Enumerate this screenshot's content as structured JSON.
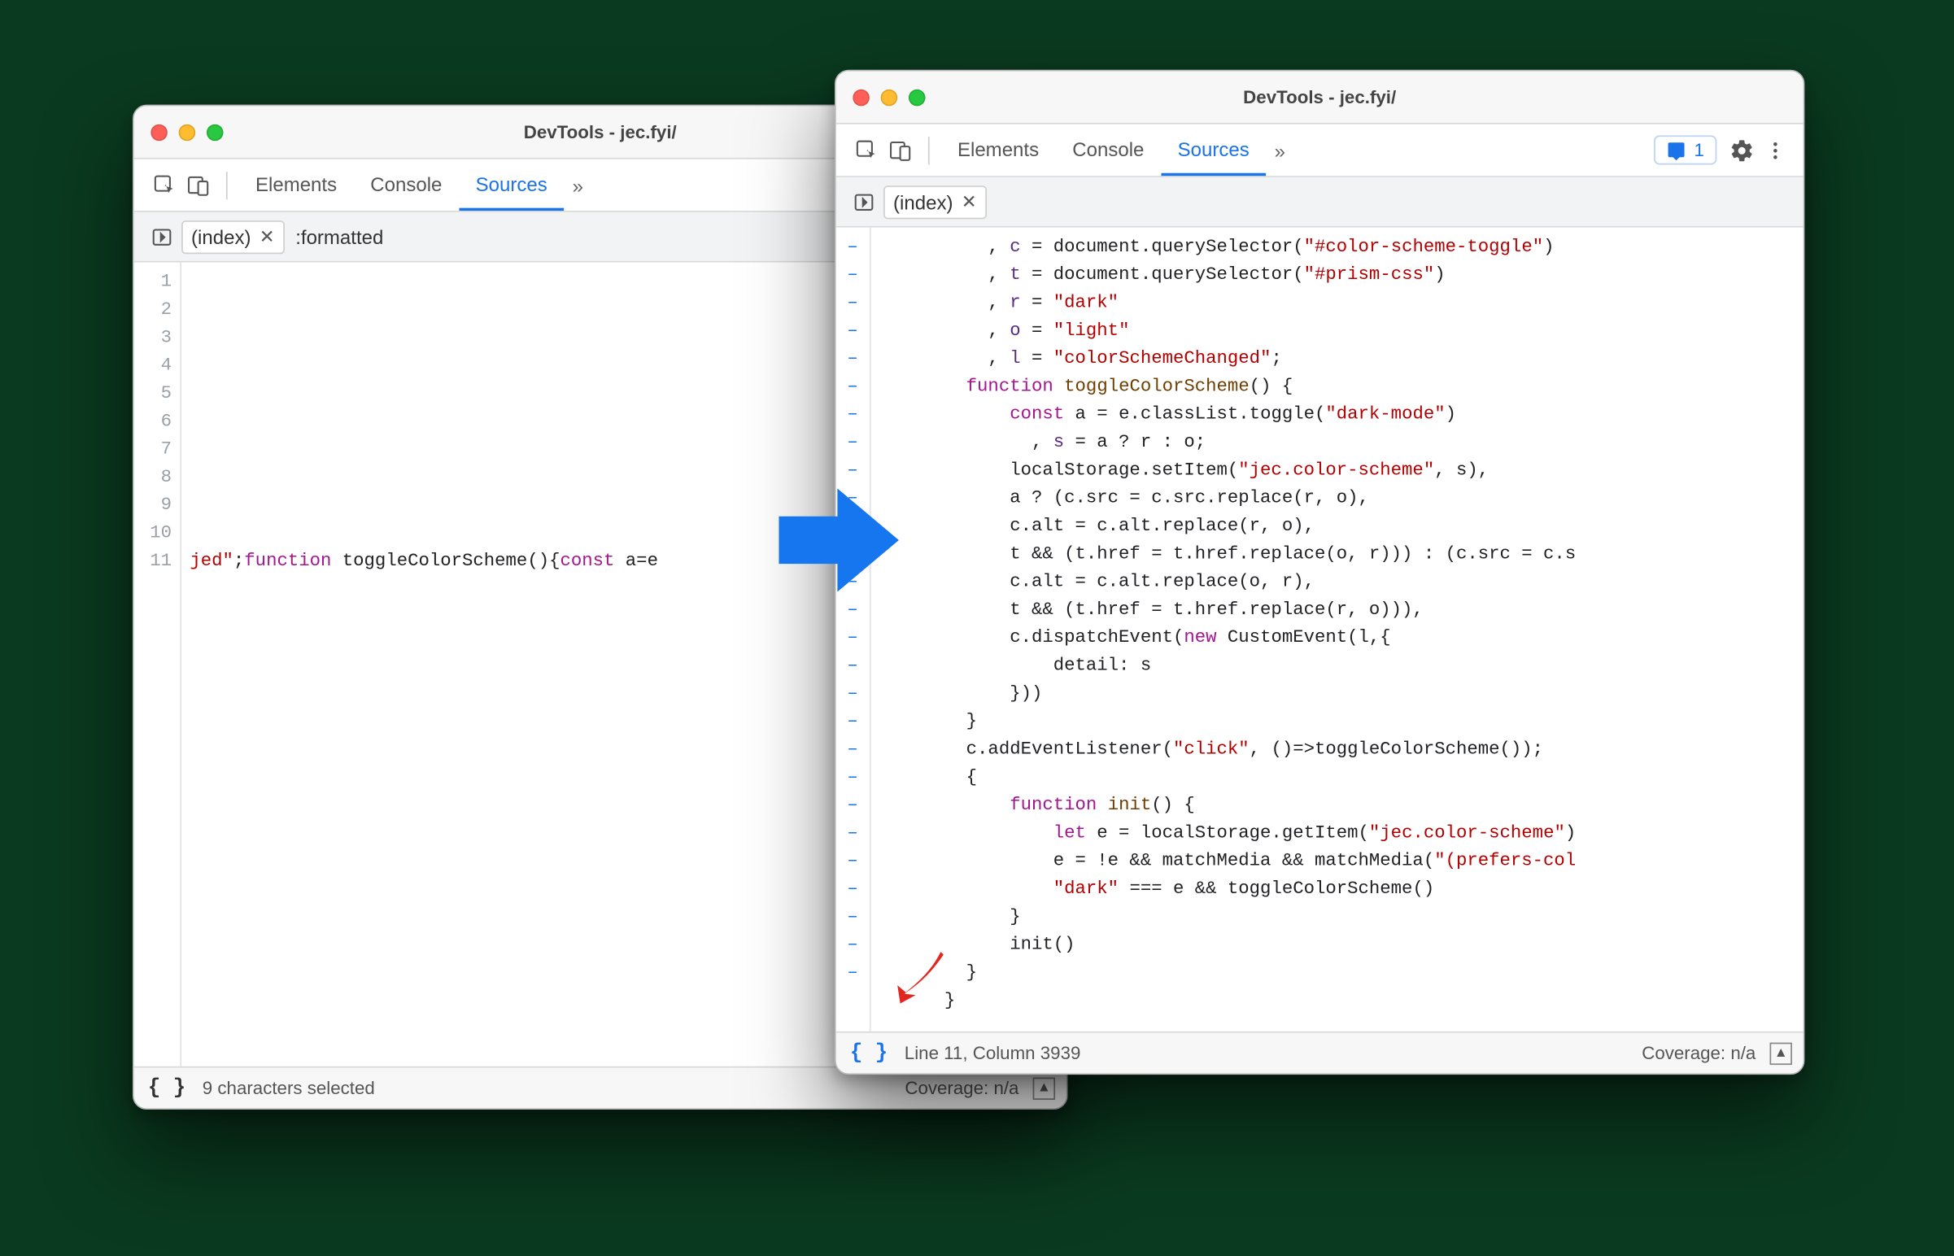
{
  "left": {
    "title": "DevTools - jec.fyi/",
    "tabs": {
      "elements": "Elements",
      "console": "Console",
      "sources": "Sources"
    },
    "subbar": {
      "file": "(index)",
      "formatted": ":formatted"
    },
    "gutter": [
      1,
      2,
      3,
      4,
      5,
      6,
      7,
      8,
      9,
      10,
      11
    ],
    "code_line11": {
      "a": "jed\"",
      "b": ";",
      "c": "function",
      "d": " toggleColorScheme(){",
      "e": "const",
      "f": " a=e"
    },
    "status": {
      "msg": "9 characters selected",
      "coverage": "Coverage: n/a"
    }
  },
  "right": {
    "title": "DevTools - jec.fyi/",
    "tabs": {
      "elements": "Elements",
      "console": "Console",
      "sources": "Sources"
    },
    "issues_count": "1",
    "subbar": {
      "file": "(index)"
    },
    "dash_rows": 27,
    "code": [
      {
        "indent": 10,
        "p": [
          [
            "p",
            ", "
          ],
          [
            "v",
            "c"
          ],
          [
            "p",
            " = document.querySelector("
          ],
          [
            "s",
            "\"#color-scheme-toggle\""
          ],
          [
            "p",
            ")"
          ]
        ]
      },
      {
        "indent": 10,
        "p": [
          [
            "p",
            ", "
          ],
          [
            "v",
            "t"
          ],
          [
            "p",
            " = document.querySelector("
          ],
          [
            "s",
            "\"#prism-css\""
          ],
          [
            "p",
            ")"
          ]
        ]
      },
      {
        "indent": 10,
        "p": [
          [
            "p",
            ", "
          ],
          [
            "v",
            "r"
          ],
          [
            "p",
            " = "
          ],
          [
            "s",
            "\"dark\""
          ]
        ]
      },
      {
        "indent": 10,
        "p": [
          [
            "p",
            ", "
          ],
          [
            "v",
            "o"
          ],
          [
            "p",
            " = "
          ],
          [
            "s",
            "\"light\""
          ]
        ]
      },
      {
        "indent": 10,
        "p": [
          [
            "p",
            ", "
          ],
          [
            "v",
            "l"
          ],
          [
            "p",
            " = "
          ],
          [
            "s",
            "\"colorSchemeChanged\""
          ],
          [
            "p",
            ";"
          ]
        ]
      },
      {
        "indent": 8,
        "p": [
          [
            "kw",
            "function"
          ],
          [
            "p",
            " "
          ],
          [
            "fn",
            "toggleColorScheme"
          ],
          [
            "p",
            "() {"
          ]
        ]
      },
      {
        "indent": 12,
        "p": [
          [
            "kw",
            "const"
          ],
          [
            "p",
            " a = e.classList.toggle("
          ],
          [
            "s",
            "\"dark-mode\""
          ],
          [
            "p",
            ")"
          ]
        ]
      },
      {
        "indent": 14,
        "p": [
          [
            "p",
            ", "
          ],
          [
            "v",
            "s"
          ],
          [
            "p",
            " = a ? r : o;"
          ]
        ]
      },
      {
        "indent": 12,
        "p": [
          [
            "p",
            "localStorage.setItem("
          ],
          [
            "s",
            "\"jec.color-scheme\""
          ],
          [
            "p",
            ", s),"
          ]
        ]
      },
      {
        "indent": 12,
        "p": [
          [
            "p",
            "a ? (c.src = c.src.replace(r, o),"
          ]
        ]
      },
      {
        "indent": 12,
        "p": [
          [
            "p",
            "c.alt = c.alt.replace(r, o),"
          ]
        ]
      },
      {
        "indent": 12,
        "p": [
          [
            "p",
            "t && (t.href = t.href.replace(o, r))) : (c.src = c.s"
          ]
        ]
      },
      {
        "indent": 12,
        "p": [
          [
            "p",
            "c.alt = c.alt.replace(o, r),"
          ]
        ]
      },
      {
        "indent": 12,
        "p": [
          [
            "p",
            "t && (t.href = t.href.replace(r, o))),"
          ]
        ]
      },
      {
        "indent": 12,
        "p": [
          [
            "p",
            "c.dispatchEvent("
          ],
          [
            "kw",
            "new"
          ],
          [
            "p",
            " CustomEvent(l,{"
          ]
        ]
      },
      {
        "indent": 16,
        "p": [
          [
            "p",
            "detail: s"
          ]
        ]
      },
      {
        "indent": 12,
        "p": [
          [
            "p",
            "}))"
          ]
        ]
      },
      {
        "indent": 8,
        "p": [
          [
            "p",
            "}"
          ]
        ]
      },
      {
        "indent": 8,
        "p": [
          [
            "p",
            "c.addEventListener("
          ],
          [
            "s",
            "\"click\""
          ],
          [
            "p",
            ", ()=>toggleColorScheme());"
          ]
        ]
      },
      {
        "indent": 8,
        "p": [
          [
            "p",
            "{"
          ]
        ]
      },
      {
        "indent": 12,
        "p": [
          [
            "kw",
            "function"
          ],
          [
            "p",
            " "
          ],
          [
            "fn",
            "init"
          ],
          [
            "p",
            "() {"
          ]
        ]
      },
      {
        "indent": 16,
        "p": [
          [
            "kw",
            "let"
          ],
          [
            "p",
            " e = localStorage.getItem("
          ],
          [
            "s",
            "\"jec.color-scheme\""
          ],
          [
            "p",
            ")"
          ]
        ]
      },
      {
        "indent": 16,
        "p": [
          [
            "p",
            "e = !e && matchMedia && matchMedia("
          ],
          [
            "s",
            "\"(prefers-col"
          ]
        ]
      },
      {
        "indent": 16,
        "p": [
          [
            "s",
            "\"dark\""
          ],
          [
            "p",
            " === e && toggleColorScheme()"
          ]
        ]
      },
      {
        "indent": 12,
        "p": [
          [
            "p",
            "}"
          ]
        ]
      },
      {
        "indent": 12,
        "p": [
          [
            "p",
            "init()"
          ]
        ]
      },
      {
        "indent": 8,
        "p": [
          [
            "p",
            "}"
          ]
        ]
      },
      {
        "indent": 6,
        "p": [
          [
            "p",
            "}"
          ]
        ]
      }
    ],
    "status": {
      "cursor": "Line 11, Column 3939",
      "coverage": "Coverage: n/a"
    }
  }
}
